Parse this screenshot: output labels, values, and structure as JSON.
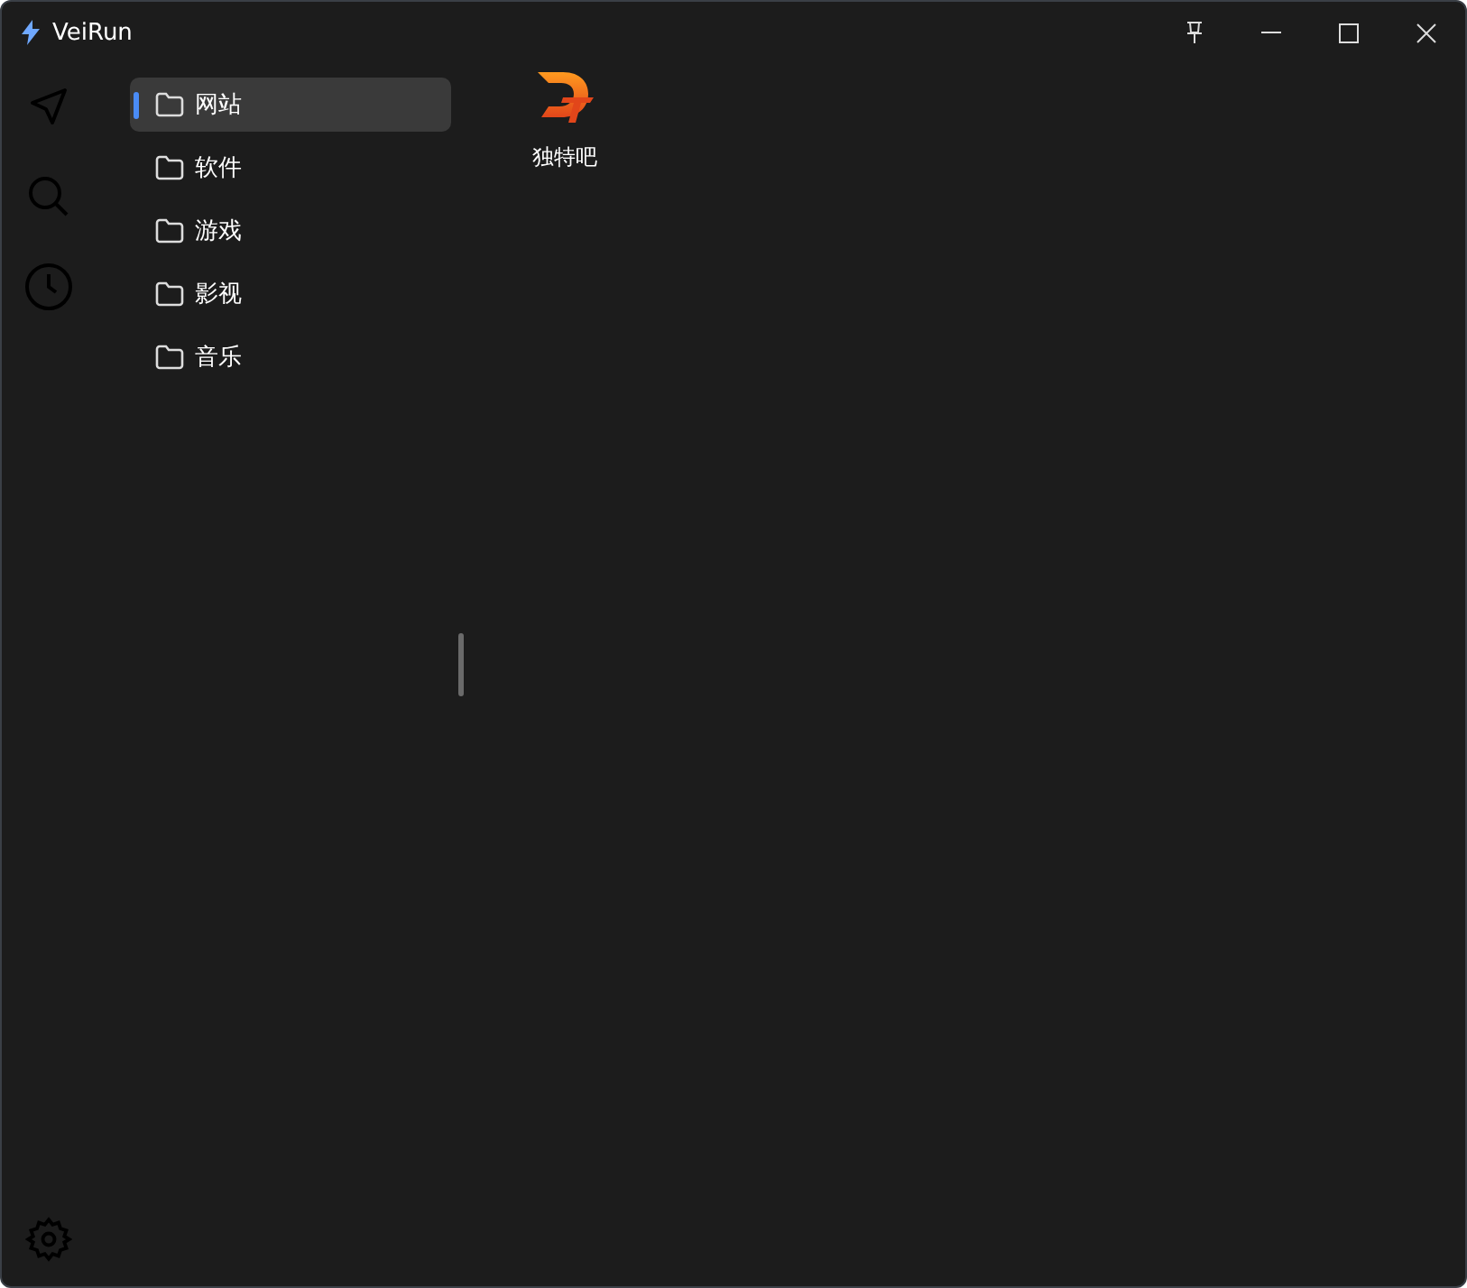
{
  "window": {
    "title": "VeiRun"
  },
  "folders": [
    {
      "label": "网站",
      "selected": true
    },
    {
      "label": "软件",
      "selected": false
    },
    {
      "label": "游戏",
      "selected": false
    },
    {
      "label": "影视",
      "selected": false
    },
    {
      "label": "音乐",
      "selected": false
    }
  ],
  "shortcuts": [
    {
      "label": "独特吧"
    }
  ]
}
